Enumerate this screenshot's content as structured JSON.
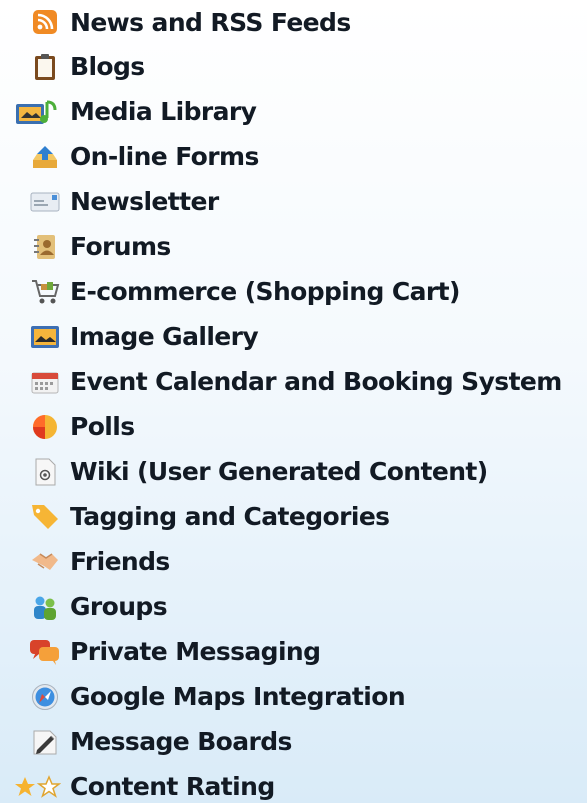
{
  "features": [
    {
      "label": "News and RSS Feeds",
      "icon": "rss-feed-icon"
    },
    {
      "label": "Blogs",
      "icon": "clipboard-icon"
    },
    {
      "label": "Media Library",
      "icon": "media-library-icon"
    },
    {
      "label": "On-line Forms",
      "icon": "form-inbox-icon"
    },
    {
      "label": "Newsletter",
      "icon": "envelope-icon"
    },
    {
      "label": "Forums",
      "icon": "address-book-icon"
    },
    {
      "label": "E-commerce (Shopping Cart)",
      "icon": "shopping-cart-icon"
    },
    {
      "label": "Image Gallery",
      "icon": "image-gallery-icon"
    },
    {
      "label": "Event Calendar and Booking System",
      "icon": "calendar-icon"
    },
    {
      "label": "Polls",
      "icon": "pie-chart-icon"
    },
    {
      "label": "Wiki (User Generated Content)",
      "icon": "document-icon"
    },
    {
      "label": "Tagging and Categories",
      "icon": "tag-icon"
    },
    {
      "label": "Friends",
      "icon": "handshake-icon"
    },
    {
      "label": "Groups",
      "icon": "group-users-icon"
    },
    {
      "label": "Private Messaging",
      "icon": "chat-bubbles-icon"
    },
    {
      "label": "Google Maps Integration",
      "icon": "compass-icon"
    },
    {
      "label": "Message Boards",
      "icon": "pen-paper-icon"
    },
    {
      "label": "Content Rating",
      "icon": "star-rating-icon"
    }
  ],
  "colors": {
    "text": "#121a24",
    "background_top": "#ffffff",
    "background_bottom": "#d9ebf8"
  }
}
